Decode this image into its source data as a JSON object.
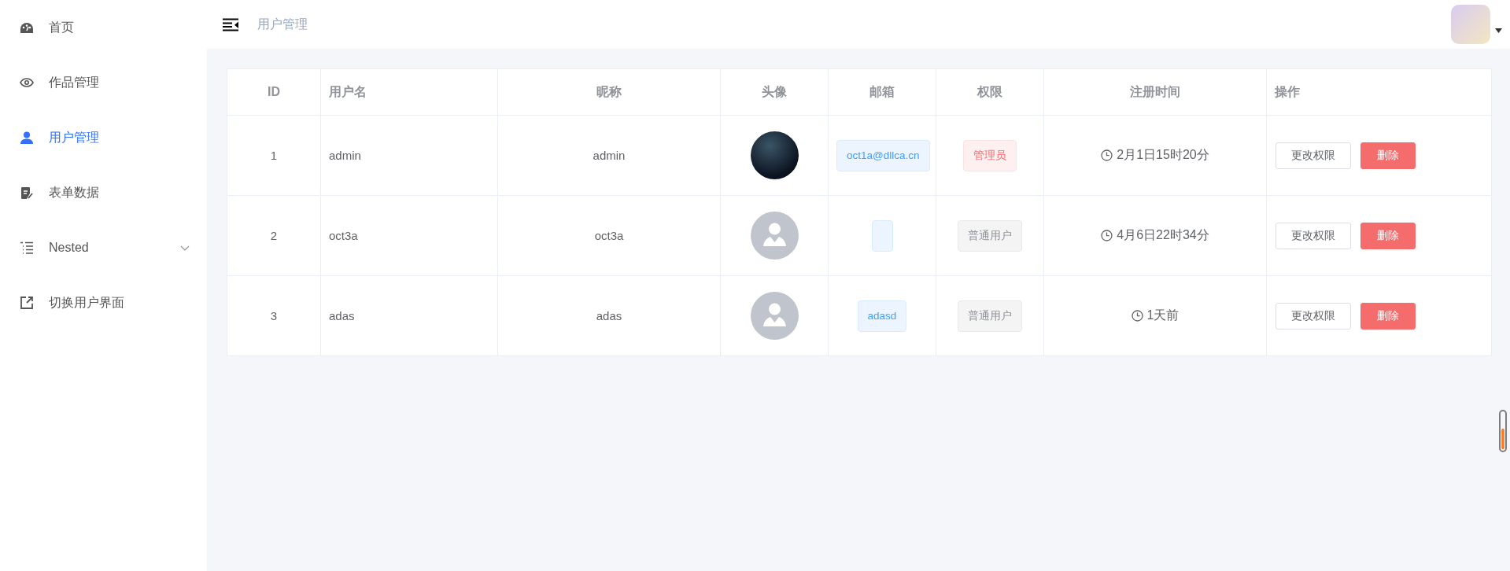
{
  "sidebar": {
    "items": [
      {
        "label": "首页",
        "kind": "link",
        "selected": false
      },
      {
        "label": "作品管理",
        "kind": "link",
        "selected": false
      },
      {
        "label": "用户管理",
        "kind": "link",
        "selected": true
      },
      {
        "label": "表单数据",
        "kind": "link",
        "selected": false
      },
      {
        "label": "Nested",
        "kind": "submenu",
        "selected": false,
        "expanded": false
      },
      {
        "label": "切换用户界面",
        "kind": "link",
        "selected": false
      }
    ]
  },
  "header": {
    "breadcrumb": "用户管理"
  },
  "table": {
    "columns": [
      "ID",
      "用户名",
      "昵称",
      "头像",
      "邮箱",
      "权限",
      "注册时间",
      "操作"
    ],
    "rows": [
      {
        "id": "1",
        "username": "admin",
        "nickname": "admin",
        "avatar": {
          "kind": "photo"
        },
        "email": {
          "text": "oct1a@dllca.cn"
        },
        "role": {
          "text": "管理员",
          "kind": "admin"
        },
        "registered": "2月1日15时20分",
        "actions": [
          "更改权限",
          "删除"
        ]
      },
      {
        "id": "2",
        "username": "oct3a",
        "nickname": "oct3a",
        "avatar": {
          "kind": "default"
        },
        "email": {},
        "role": {
          "text": "普通用户",
          "kind": "user"
        },
        "registered": "4月6日22时34分",
        "actions": [
          "更改权限",
          "删除"
        ]
      },
      {
        "id": "3",
        "username": "adas",
        "nickname": "adas",
        "avatar": {
          "kind": "default"
        },
        "email": {
          "text": "adasd"
        },
        "role": {
          "text": "普通用户",
          "kind": "user"
        },
        "registered": "1天前",
        "actions": [
          "更改权限",
          "删除"
        ]
      }
    ]
  }
}
